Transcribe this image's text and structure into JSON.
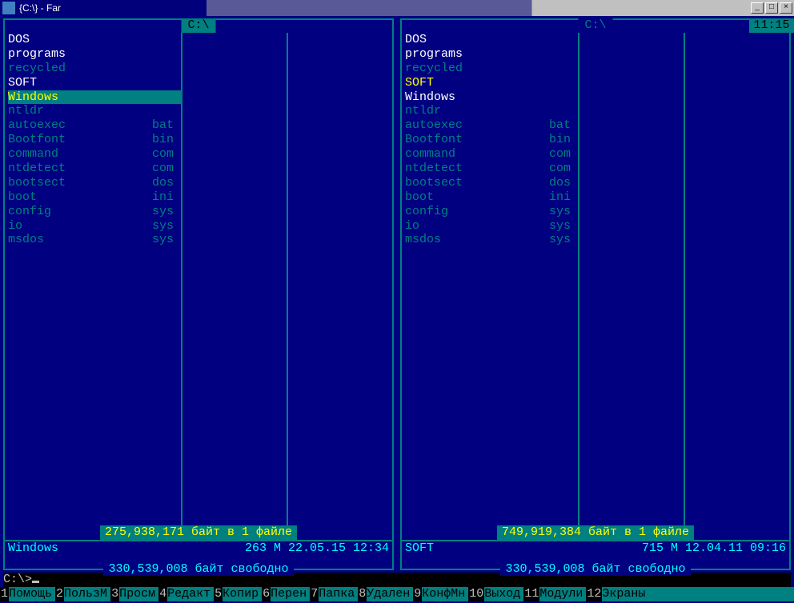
{
  "window": {
    "title": "{C:\\} - Far"
  },
  "clock": "11:15",
  "left_panel": {
    "path": " C:\\ ",
    "active": true,
    "files": [
      {
        "name": "DOS",
        "ext": "",
        "class": "c-white"
      },
      {
        "name": "programs",
        "ext": "",
        "class": "c-white"
      },
      {
        "name": "recycled",
        "ext": "",
        "class": "c-dcyan"
      },
      {
        "name": "SOFT",
        "ext": "",
        "class": "c-white"
      },
      {
        "name": "Windows",
        "ext": "",
        "class": "c-yellow",
        "selected": true
      },
      {
        "name": "ntldr",
        "ext": "",
        "class": "c-dcyan"
      },
      {
        "name": "autoexec",
        "ext": "bat",
        "class": "c-dcyan"
      },
      {
        "name": "Bootfont",
        "ext": "bin",
        "class": "c-dcyan"
      },
      {
        "name": "command",
        "ext": "com",
        "class": "c-dcyan"
      },
      {
        "name": "ntdetect",
        "ext": "com",
        "class": "c-dcyan"
      },
      {
        "name": "bootsect",
        "ext": "dos",
        "class": "c-dcyan"
      },
      {
        "name": "boot",
        "ext": "ini",
        "class": "c-dcyan"
      },
      {
        "name": "config",
        "ext": "sys",
        "class": "c-dcyan"
      },
      {
        "name": "io",
        "ext": "sys",
        "class": "c-dcyan"
      },
      {
        "name": "msdos",
        "ext": "sys",
        "class": "c-dcyan"
      }
    ],
    "summary": "275,938,171 байт в 1 файле",
    "info_name": "Windows",
    "info_right": "263 M 22.05.15 12:34",
    "free": "330,539,008 байт свободно"
  },
  "right_panel": {
    "path": " C:\\ ",
    "active": false,
    "files": [
      {
        "name": "DOS",
        "ext": "",
        "class": "c-white"
      },
      {
        "name": "programs",
        "ext": "",
        "class": "c-white"
      },
      {
        "name": "recycled",
        "ext": "",
        "class": "c-dcyan"
      },
      {
        "name": "SOFT",
        "ext": "",
        "class": "c-yellow"
      },
      {
        "name": "Windows",
        "ext": "",
        "class": "c-white"
      },
      {
        "name": "ntldr",
        "ext": "",
        "class": "c-dcyan"
      },
      {
        "name": "autoexec",
        "ext": "bat",
        "class": "c-dcyan"
      },
      {
        "name": "Bootfont",
        "ext": "bin",
        "class": "c-dcyan"
      },
      {
        "name": "command",
        "ext": "com",
        "class": "c-dcyan"
      },
      {
        "name": "ntdetect",
        "ext": "com",
        "class": "c-dcyan"
      },
      {
        "name": "bootsect",
        "ext": "dos",
        "class": "c-dcyan"
      },
      {
        "name": "boot",
        "ext": "ini",
        "class": "c-dcyan"
      },
      {
        "name": "config",
        "ext": "sys",
        "class": "c-dcyan"
      },
      {
        "name": "io",
        "ext": "sys",
        "class": "c-dcyan"
      },
      {
        "name": "msdos",
        "ext": "sys",
        "class": "c-dcyan"
      }
    ],
    "summary": "749,919,384 байт в 1 файле",
    "info_name": "SOFT",
    "info_right": "715 M 12.04.11 09:16",
    "free": "330,539,008 байт свободно"
  },
  "cmdline": "C:\\>",
  "keybar": [
    {
      "num": "1",
      "label": "Помощь"
    },
    {
      "num": "2",
      "label": "ПользМ"
    },
    {
      "num": "3",
      "label": "Просм"
    },
    {
      "num": "4",
      "label": "Редакт"
    },
    {
      "num": "5",
      "label": "Копир"
    },
    {
      "num": "6",
      "label": "Перен"
    },
    {
      "num": "7",
      "label": "Папка"
    },
    {
      "num": "8",
      "label": "Удален"
    },
    {
      "num": "9",
      "label": "КонфМн"
    },
    {
      "num": "10",
      "label": "Выход"
    },
    {
      "num": "11",
      "label": "Модули"
    },
    {
      "num": "12",
      "label": "Экраны"
    }
  ]
}
